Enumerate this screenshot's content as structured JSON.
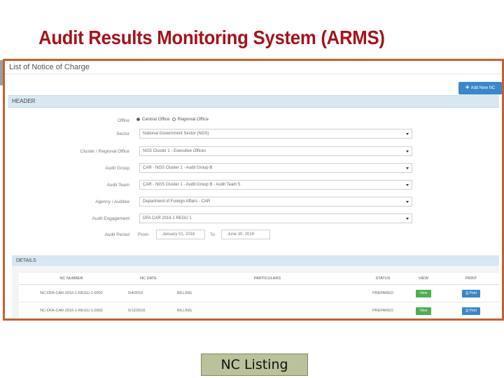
{
  "slide": {
    "title": "Audit Results Monitoring System (ARMS)",
    "caption": "NC Listing"
  },
  "window": {
    "title": "List of Notice of Charge",
    "add_button": "Add New NC"
  },
  "header": {
    "label": "HEADER",
    "office": {
      "label": "Office",
      "options": [
        "Central Office",
        "Regional Office"
      ],
      "selected": "Central Office"
    },
    "fields": [
      {
        "label": "Sector",
        "value": "National Government Sector (NGS)"
      },
      {
        "label": "Cluster / Regional Office",
        "value": "NGS Cluster 1 - Executive Offices"
      },
      {
        "label": "Audit Group",
        "value": "CAR - NGS Cluster 1 - Audit Group B"
      },
      {
        "label": "Audit Team",
        "value": "CAR - NGS Cluster 1 - Audit Group B - Audit Team 5"
      },
      {
        "label": "Agency / Auditee",
        "value": "Department of Foreign Affairs - CAR"
      },
      {
        "label": "Audit Engagement",
        "value": "DFA CAR 2016 1 REGU 1"
      }
    ],
    "period": {
      "label": "Audit Period",
      "from_label": "From",
      "from_value": "January 01, 2016",
      "to_label": "To",
      "to_value": "June 30, 2016"
    }
  },
  "details": {
    "label": "DETAILS",
    "columns": [
      "NC NUMBER",
      "NC DATE",
      "PARTICULARS",
      "STATUS",
      "VIEW",
      "PRINT"
    ],
    "rows": [
      {
        "nc_number": "NC-DFA-CAR-2016-1-REGU-1-0001",
        "nc_date": "5/4/2016",
        "particulars": "BILLING",
        "status": "PREPARED",
        "view": "View",
        "print": "Print"
      },
      {
        "nc_number": "NC-DFA-CAR-2016-1-REGU-1-0002",
        "nc_date": "5/12/2016",
        "particulars": "BILLING",
        "status": "PREPARED",
        "view": "View",
        "print": "Print"
      }
    ]
  },
  "colors": {
    "title": "#a5121a",
    "frame_border": "#c0622f",
    "section_bar": "#d7e8f3",
    "primary_button": "#3a87c9",
    "view_button": "#4caf50",
    "caption_bg": "#b9c29a"
  },
  "icons": [
    "plus-icon",
    "caret-icon",
    "print-icon"
  ]
}
